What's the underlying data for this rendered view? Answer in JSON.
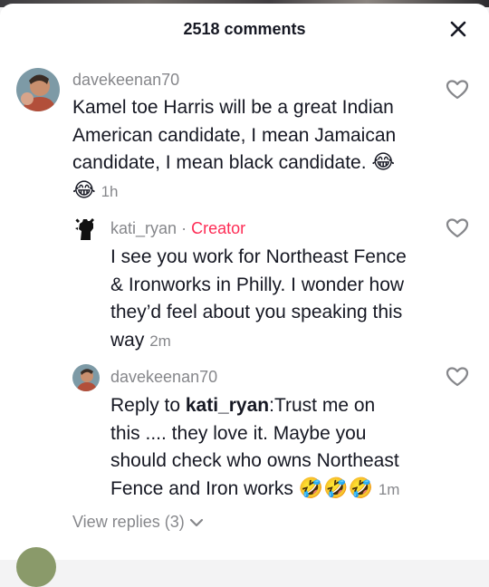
{
  "header": {
    "title": "2518 comments"
  },
  "comments": [
    {
      "username": "davekeenan70",
      "text": "Kamel toe Harris will be a great Indian American candidate, I mean Jamaican candidate, I mean black candidate.",
      "emoji_1": "😂",
      "emoji_2": "😂",
      "time": "1h"
    }
  ],
  "replies": [
    {
      "username": "kati_ryan",
      "separator": "·",
      "badge": "Creator",
      "line1": "I see you work for Northeast Fence",
      "line2": "& Ironworks in Philly. I wonder how",
      "line3": "they’d feel about you speaking this",
      "line4": "way",
      "time": "2m"
    },
    {
      "username": "davekeenan70",
      "reply_prefix": "Reply to ",
      "mention": "kati_ryan",
      "line1_rest": ":Trust me on",
      "line2": "this .... they love it. Maybe you",
      "line3": "should check who owns Northeast",
      "line4": "Fence and Iron works",
      "emojis": "🤣🤣🤣",
      "time": "1m"
    }
  ],
  "view_replies": {
    "label": "View replies (3)"
  },
  "icons": {
    "close": "close-icon",
    "heart": "heart-outline-icon",
    "chevron": "chevron-down-icon"
  },
  "colors": {
    "creator": "#fe2c55",
    "muted": "#86878b",
    "text": "#161823"
  }
}
